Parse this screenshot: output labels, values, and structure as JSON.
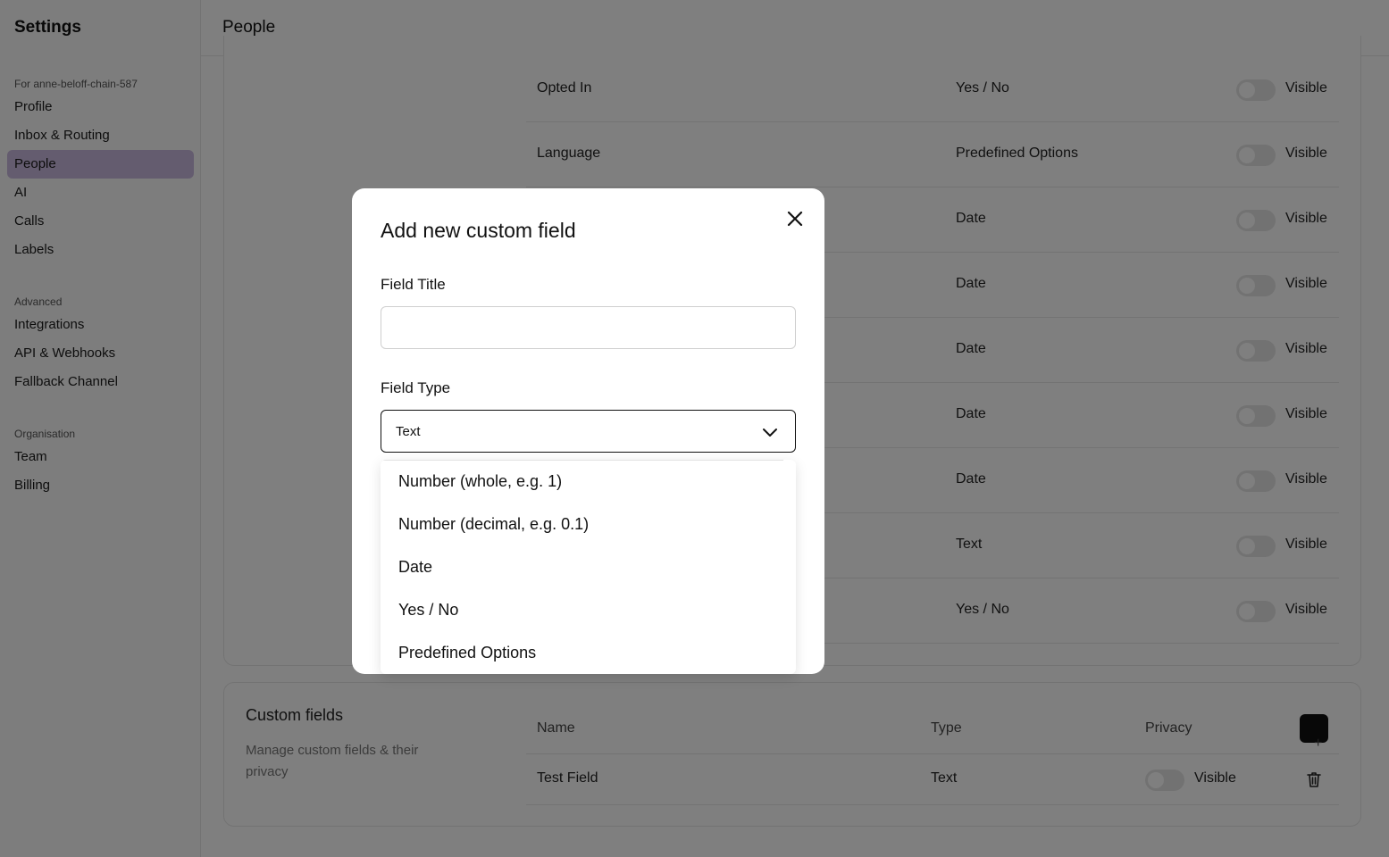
{
  "sidebar": {
    "title": "Settings",
    "sections": [
      {
        "label": "For anne-beloff-chain-587",
        "items": [
          "Profile",
          "Inbox & Routing",
          "People",
          "AI",
          "Calls",
          "Labels"
        ]
      },
      {
        "label": "Advanced",
        "items": [
          "Integrations",
          "API & Webhooks",
          "Fallback Channel"
        ]
      },
      {
        "label": "Organisation",
        "items": [
          "Team",
          "Billing"
        ]
      }
    ],
    "active_item": "People"
  },
  "header": {
    "title": "People"
  },
  "fields_table": {
    "rows": [
      {
        "name": "Opted In",
        "type": "Yes / No",
        "privacy": "Visible"
      },
      {
        "name": "Language",
        "type": "Predefined Options",
        "privacy": "Visible"
      },
      {
        "name": "",
        "type": "Date",
        "privacy": "Visible"
      },
      {
        "name": "",
        "type": "Date",
        "privacy": "Visible"
      },
      {
        "name": "",
        "type": "Date",
        "privacy": "Visible"
      },
      {
        "name": "",
        "type": "Date",
        "privacy": "Visible"
      },
      {
        "name": "",
        "type": "Date",
        "privacy": "Visible"
      },
      {
        "name": "",
        "type": "Text",
        "privacy": "Visible"
      },
      {
        "name": "",
        "type": "Yes / No",
        "privacy": "Visible"
      }
    ]
  },
  "custom_fields": {
    "title": "Custom fields",
    "description": "Manage custom fields & their privacy",
    "columns": {
      "name": "Name",
      "type": "Type",
      "privacy": "Privacy"
    },
    "add_icon": "plus-icon",
    "rows": [
      {
        "name": "Test Field",
        "type": "Text",
        "privacy": "Visible",
        "delete_icon": "trash-icon"
      }
    ]
  },
  "modal": {
    "title": "Add new custom field",
    "close_icon": "close-icon",
    "field_title_label": "Field Title",
    "field_title_value": "",
    "field_type_label": "Field Type",
    "field_type_value": "Text",
    "field_type_icon": "chevron-down-icon",
    "options": [
      "Number (whole, e.g. 1)",
      "Number (decimal, e.g. 0.1)",
      "Date",
      "Yes / No",
      "Predefined Options"
    ]
  },
  "colors": {
    "active_nav": "#c9b8de",
    "overlay": "rgba(0,0,0,0.5)",
    "add_button": "#111111"
  }
}
